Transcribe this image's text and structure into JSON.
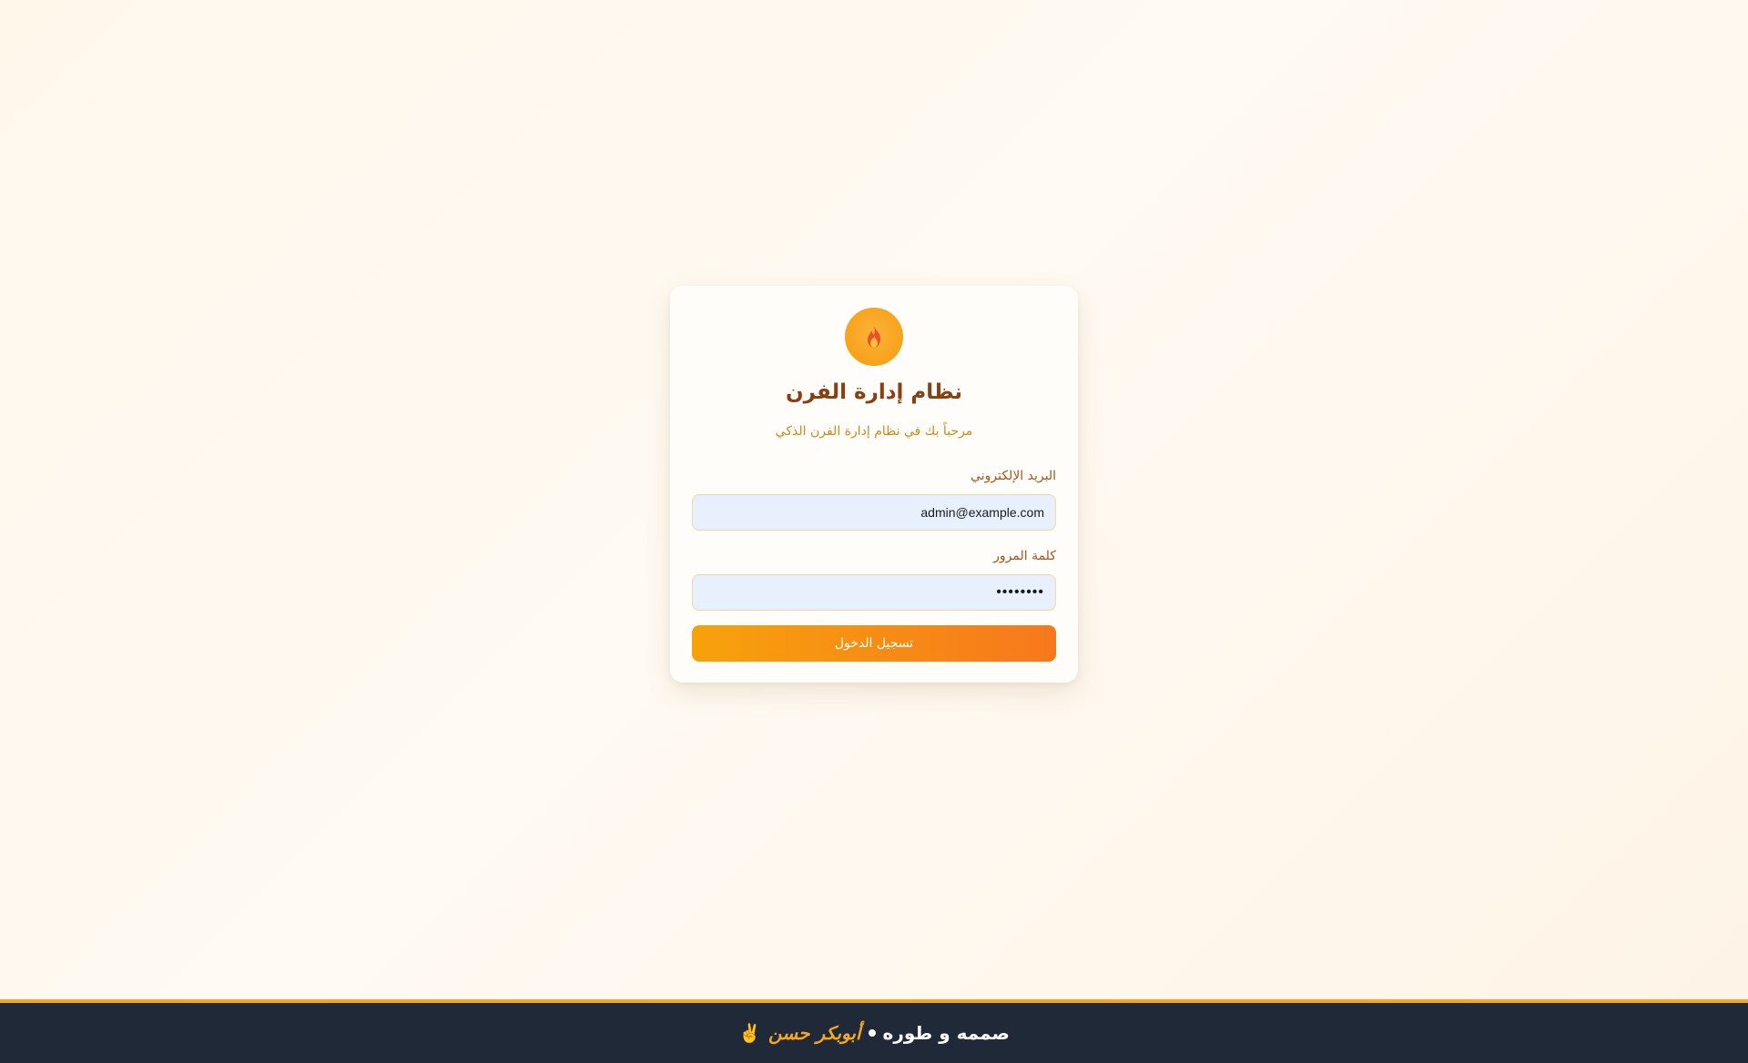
{
  "login": {
    "icon": "flame-icon",
    "title": "نظام إدارة الفرن",
    "subtitle": "مرحباً بك في نظام إدارة الفرن الذكي",
    "email_label": "البريد الإلكتروني",
    "email_value": "admin@example.com",
    "password_label": "كلمة المرور",
    "password_value": "••••••••",
    "submit_label": "تسجيل الدخول"
  },
  "footer": {
    "prefix": "صممه و طوره",
    "author": "أبوبكر حسن",
    "emoji": "✌️"
  },
  "colors": {
    "accent": "#f7a21a",
    "title": "#8a3f12",
    "footer_bg": "#1f2937",
    "footer_border": "#f5a623"
  }
}
